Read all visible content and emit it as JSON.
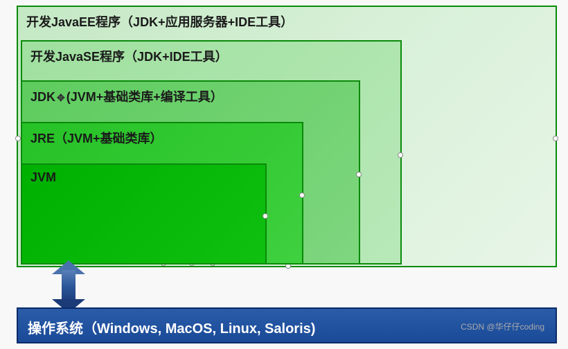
{
  "layers": {
    "javaee": "开发JavaEE程序（JDK+应用服务器+IDE工具）",
    "javase": "开发JavaSE程序（JDK+IDE工具）",
    "jdk_pre": "JDK",
    "jdk_post": "(JVM+基础类库+编译工具）",
    "jre": "JRE（JVM+基础类库）",
    "jvm": "JVM"
  },
  "os": {
    "label": "操作系统（Windows, MacOS, Linux, Saloris)"
  },
  "watermark": "CSDN @华仔仔coding",
  "cursor_symbol": "✥"
}
